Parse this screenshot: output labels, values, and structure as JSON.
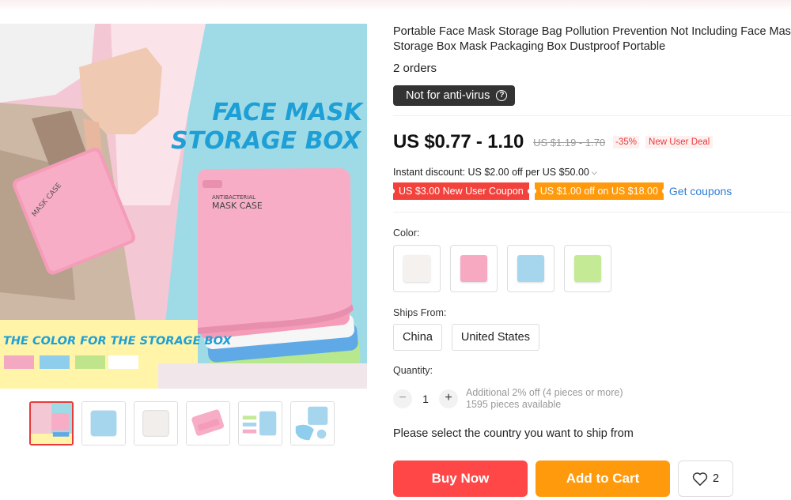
{
  "gallery": {
    "main_image": {
      "headline_line1": "FACE MASK",
      "headline_line2": "STORAGE BOX",
      "case_label_1": "ANTIBACTERIAL",
      "case_label_2": "MASK CASE",
      "bottom_caption": "THE COLOR FOR THE STORAGE BOX"
    },
    "thumbnails": [
      "thumb-1",
      "thumb-2",
      "thumb-3",
      "thumb-4",
      "thumb-5",
      "thumb-6"
    ]
  },
  "product": {
    "title": "Portable Face Mask Storage Bag Pollution Prevention Not Including Face Mask Storage Box Mask Packaging Box Dustproof Portable",
    "orders": "2 orders",
    "antivirus_badge": "Not for anti-virus",
    "price": "US $0.77 - 1.10",
    "old_price": "US $1.19 - 1.70",
    "discount": "-35%",
    "deal": "New User Deal",
    "instant_discount": "Instant discount: US $2.00 off per US $50.00",
    "coupon_1": "US $3.00 New User Coupon",
    "coupon_2": "US $1.00 off on US $18.00",
    "get_coupons": "Get coupons",
    "color_label": "Color:",
    "colors": [
      "#f4f1ef",
      "#f7a9c2",
      "#a6d5ee",
      "#c4ea95"
    ],
    "ships_from_label": "Ships From:",
    "ships_from": [
      "China",
      "United States"
    ],
    "quantity_label": "Quantity:",
    "quantity": "1",
    "qty_info_1": "Additional 2% off (4 pieces or more)",
    "qty_info_2": "1595 pieces available",
    "ship_note": "Please select the country you want to ship from",
    "buy_now": "Buy Now",
    "add_to_cart": "Add to Cart",
    "wishlist_count": "2"
  },
  "colors": {
    "accent_red": "#ff4747",
    "accent_orange": "#ff9a0c",
    "link_blue": "#2e7dd7"
  }
}
